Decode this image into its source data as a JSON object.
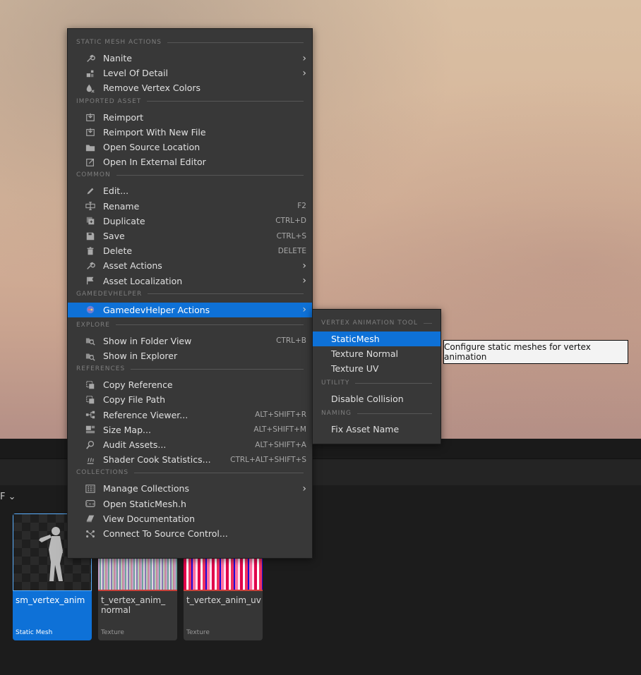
{
  "context_menu": {
    "sections": [
      {
        "header": "STATIC MESH ACTIONS",
        "items": [
          {
            "label": "Nanite",
            "icon": "wrench-icon",
            "submenu": true
          },
          {
            "label": "Level Of Detail",
            "icon": "lod-icon",
            "submenu": true
          },
          {
            "label": "Remove Vertex Colors",
            "icon": "paint-drop-icon"
          }
        ]
      },
      {
        "header": "IMPORTED ASSET",
        "items": [
          {
            "label": "Reimport",
            "icon": "reimport-icon"
          },
          {
            "label": "Reimport With New File",
            "icon": "reimport-icon"
          },
          {
            "label": "Open Source Location",
            "icon": "folder-icon"
          },
          {
            "label": "Open In External Editor",
            "icon": "external-link-icon"
          }
        ]
      },
      {
        "header": "COMMON",
        "items": [
          {
            "label": "Edit...",
            "icon": "pencil-icon"
          },
          {
            "label": "Rename",
            "icon": "rename-icon",
            "shortcut": "F2"
          },
          {
            "label": "Duplicate",
            "icon": "duplicate-icon",
            "shortcut": "CTRL+D"
          },
          {
            "label": "Save",
            "icon": "save-icon",
            "shortcut": "CTRL+S"
          },
          {
            "label": "Delete",
            "icon": "trash-icon",
            "shortcut": "DELETE"
          },
          {
            "label": "Asset Actions",
            "icon": "wrench-icon",
            "submenu": true
          },
          {
            "label": "Asset Localization",
            "icon": "flag-icon",
            "submenu": true
          }
        ]
      },
      {
        "header": "GAMEDEVHELPER",
        "items": [
          {
            "label": "GamedevHelper Actions",
            "icon": "gamedevhelper-icon",
            "submenu": true,
            "highlighted": true
          }
        ]
      },
      {
        "header": "EXPLORE",
        "items": [
          {
            "label": "Show in Folder View",
            "icon": "folder-search-icon",
            "shortcut": "CTRL+B"
          },
          {
            "label": "Show in Explorer",
            "icon": "folder-search-icon"
          }
        ]
      },
      {
        "header": "REFERENCES",
        "items": [
          {
            "label": "Copy Reference",
            "icon": "copy-icon"
          },
          {
            "label": "Copy File Path",
            "icon": "copy-icon"
          },
          {
            "label": "Reference Viewer...",
            "icon": "reference-viewer-icon",
            "shortcut": "ALT+SHIFT+R"
          },
          {
            "label": "Size Map...",
            "icon": "size-map-icon",
            "shortcut": "ALT+SHIFT+M"
          },
          {
            "label": "Audit Assets...",
            "icon": "audit-icon",
            "shortcut": "ALT+SHIFT+A"
          },
          {
            "label": "Shader Cook Statistics...",
            "icon": "shader-icon",
            "shortcut": "CTRL+ALT+SHIFT+S"
          }
        ]
      },
      {
        "header": "COLLECTIONS",
        "items": [
          {
            "label": "Manage Collections",
            "icon": "collections-icon",
            "submenu": true
          },
          {
            "label": "Open StaticMesh.h",
            "icon": "cpp-file-icon"
          },
          {
            "label": "View Documentation",
            "icon": "book-icon"
          },
          {
            "label": "Connect To Source Control...",
            "icon": "source-control-icon"
          }
        ]
      }
    ]
  },
  "submenu": {
    "sections": [
      {
        "header": "VERTEX ANIMATION TOOL",
        "items": [
          {
            "label": "StaticMesh",
            "highlighted": true
          },
          {
            "label": "Texture Normal"
          },
          {
            "label": "Texture UV"
          }
        ]
      },
      {
        "header": "UTILITY",
        "items": [
          {
            "label": "Disable Collision"
          }
        ]
      },
      {
        "header": "NAMING",
        "items": [
          {
            "label": "Fix Asset Name"
          }
        ]
      }
    ]
  },
  "tooltip": {
    "text": "Configure static meshes for vertex animation"
  },
  "assets": [
    {
      "name": "sm_vertex_anim",
      "type": "Static Mesh",
      "selected": true
    },
    {
      "name": "t_vertex_anim_\nnormal",
      "type": "Texture"
    },
    {
      "name": "t_vertex_anim_uv",
      "type": "Texture"
    }
  ],
  "filter": {
    "glyph": "F"
  },
  "colors": {
    "highlight": "#0e71d7",
    "menu_bg": "#383838"
  }
}
